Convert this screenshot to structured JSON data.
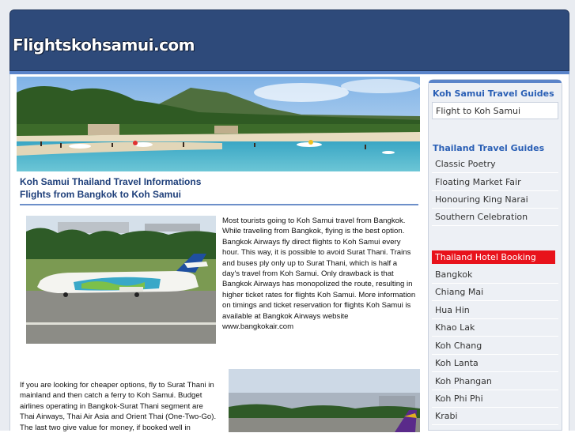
{
  "site": {
    "logo": "Flightskohsamui.com"
  },
  "main": {
    "title1": "Koh Samui Thailand Travel Informations",
    "title2": "Flights from Bangkok to Koh Samui",
    "para1": "Most tourists going to Koh Samui travel from Bangkok. While traveling from Bangkok, flying is the best option. Bangkok Airways fly direct flights to Koh Samui every hour. This way, it is possible to avoid Surat Thani. Trains and buses ply only up to Surat Thani, which is half a day's travel from Koh Samui. Only drawback is that Bangkok Airways has monopolized the route, resulting in higher ticket rates for flights Koh Samui. More information on timings and ticket reservation for flights Koh Samui is available at Bangkok Airways website www.bangkokair.com",
    "para2": "If you are looking for cheaper options, fly to Surat Thani in mainland and then catch a ferry to Koh Samui. Budget airlines operating in Bangkok-Surat Thani segment are Thai Airways, Thai Air Asia and Orient Thai (One-Two-Go). The last two give value for money, if booked well in"
  },
  "sidebar": {
    "guides_head": "Koh Samui Travel Guides",
    "guides_item": "Flight to Koh Samui",
    "thai_head": "Thailand Travel Guides",
    "thai_items": [
      "Classic Poetry",
      "Floating Market Fair",
      "Honouring King Narai",
      "Southern Celebration"
    ],
    "hotel_head": "Thailand Hotel Booking",
    "hotel_items": [
      "Bangkok",
      "Chiang Mai",
      "Hua Hin",
      "Khao Lak",
      "Koh Chang",
      "Koh Lanta",
      "Koh Phangan",
      "Koh Phi Phi",
      "Krabi"
    ]
  }
}
